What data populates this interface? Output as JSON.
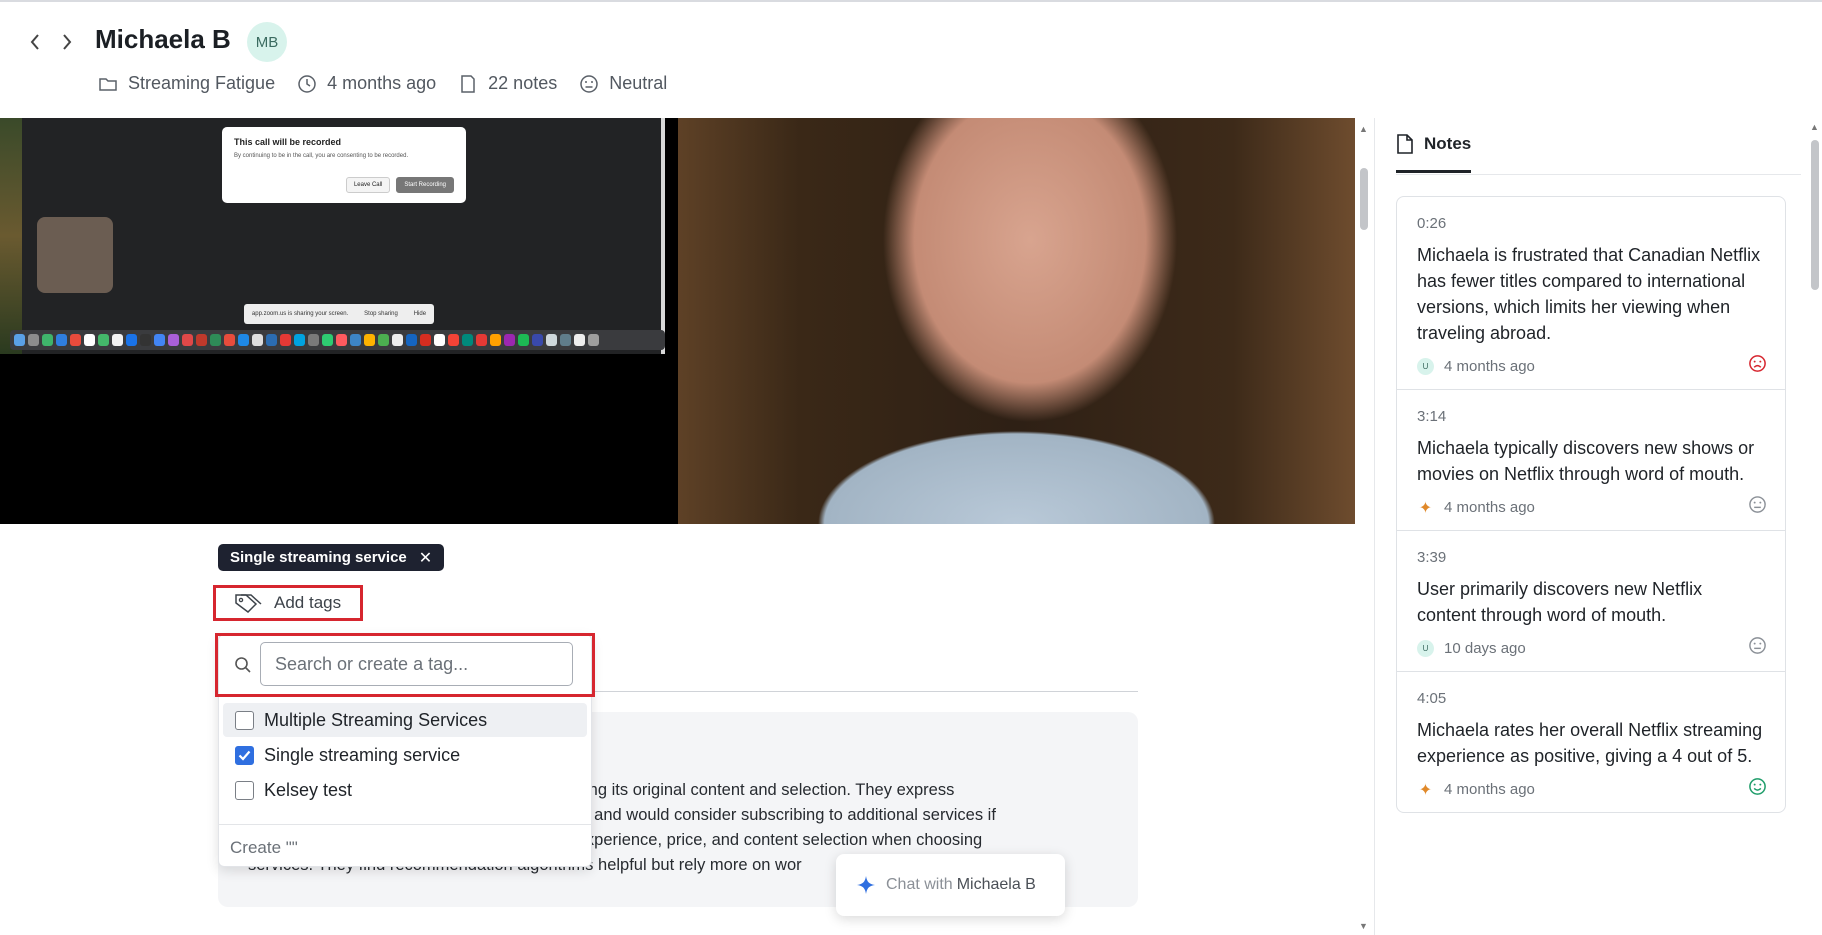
{
  "header": {
    "title": "Michaela B",
    "avatar_initials": "MB",
    "meta": {
      "project": "Streaming Fatigue",
      "time": "4 months ago",
      "notes_count": "22 notes",
      "sentiment": "Neutral"
    }
  },
  "video": {
    "dialog_title": "This call will be recorded",
    "dialog_text": "By continuing to be in the call, you are consenting to be recorded.",
    "leave_label": "Leave Call",
    "start_label": "Start Recording",
    "share_text": "app.zoom.us is sharing your screen.",
    "stop_label": "Stop sharing",
    "hide_label": "Hide"
  },
  "tags": {
    "applied": [
      "Single streaming service"
    ],
    "add_label": "Add tags",
    "search_placeholder": "Search or create a tag...",
    "options": [
      {
        "label": "Multiple Streaming Services",
        "checked": false
      },
      {
        "label": "Single streaming service",
        "checked": true
      },
      {
        "label": "Kelsey test",
        "checked": false
      }
    ],
    "create_label": "Create \"\""
  },
  "summary": {
    "line1": "aluing its original content and selection. They express",
    "line2": "ons and would consider subscribing to additional services if",
    "line3": "e experience, price, and content selection when choosing",
    "line4": "services. They find recommendation algorithms helpful but rely more on wor"
  },
  "chat": {
    "prefix": "Chat with",
    "name": "Michaela B"
  },
  "notes": {
    "tab_label": "Notes",
    "items": [
      {
        "time": "0:26",
        "text": "Michaela is frustrated that Canadian Netflix has fewer titles compared to international versions, which limits her viewing when traveling abroad.",
        "author": "user",
        "author_initial": "U",
        "age": "4 months ago",
        "sentiment": "negative"
      },
      {
        "time": "3:14",
        "text": "Michaela typically discovers new shows or movies on Netflix through word of mouth.",
        "author": "ai",
        "author_initial": "✦",
        "age": "4 months ago",
        "sentiment": "neutral"
      },
      {
        "time": "3:39",
        "text": "User primarily discovers new Netflix content through word of mouth.",
        "author": "user",
        "author_initial": "U",
        "age": "10 days ago",
        "sentiment": "neutral"
      },
      {
        "time": "4:05",
        "text": "Michaela rates her overall Netflix streaming experience as positive, giving a 4 out of 5.",
        "author": "ai",
        "author_initial": "✦",
        "age": "4 months ago",
        "sentiment": "positive"
      }
    ]
  },
  "colors": {
    "highlight_box": "#d6262f",
    "checkbox_on": "#2f6fe0",
    "negative": "#d6262f",
    "positive": "#1f9d6a",
    "neutral": "#8b9097"
  }
}
